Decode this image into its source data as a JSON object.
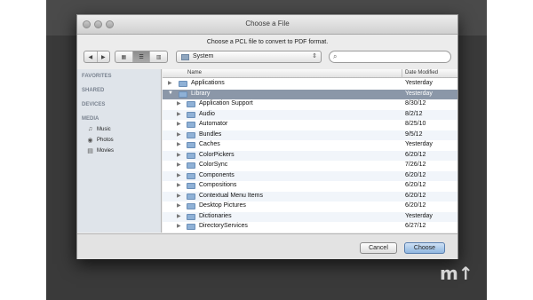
{
  "window": {
    "title": "Choose a File",
    "prompt": "Choose a PCL file to convert to PDF format."
  },
  "toolbar": {
    "back_icon": "chevron-left-icon",
    "forward_icon": "chevron-right-icon",
    "view_icons": [
      "icon-view-icon",
      "list-view-icon",
      "column-view-icon"
    ],
    "active_view": "list",
    "location": "System",
    "search_placeholder": ""
  },
  "sidebar": {
    "sections": [
      {
        "label": "FAVORITES"
      },
      {
        "label": "SHARED"
      },
      {
        "label": "DEVICES"
      },
      {
        "label": "MEDIA"
      }
    ],
    "media_items": [
      {
        "label": "Music",
        "icon": "music-note-icon"
      },
      {
        "label": "Photos",
        "icon": "camera-icon"
      },
      {
        "label": "Movies",
        "icon": "film-icon"
      }
    ]
  },
  "columns": {
    "name": "Name",
    "date": "Date Modified"
  },
  "rows": [
    {
      "name": "Applications",
      "date": "Yesterday",
      "level": 0,
      "expanded": false
    },
    {
      "name": "Library",
      "date": "Yesterday",
      "level": 0,
      "expanded": true,
      "selected": true
    },
    {
      "name": "Application Support",
      "date": "8/30/12",
      "level": 1
    },
    {
      "name": "Audio",
      "date": "8/2/12",
      "level": 1
    },
    {
      "name": "Automator",
      "date": "8/25/10",
      "level": 1
    },
    {
      "name": "Bundles",
      "date": "9/5/12",
      "level": 1
    },
    {
      "name": "Caches",
      "date": "Yesterday",
      "level": 1
    },
    {
      "name": "ColorPickers",
      "date": "6/20/12",
      "level": 1
    },
    {
      "name": "ColorSync",
      "date": "7/26/12",
      "level": 1
    },
    {
      "name": "Components",
      "date": "6/20/12",
      "level": 1
    },
    {
      "name": "Compositions",
      "date": "6/20/12",
      "level": 1
    },
    {
      "name": "Contextual Menu Items",
      "date": "6/20/12",
      "level": 1
    },
    {
      "name": "Desktop Pictures",
      "date": "6/20/12",
      "level": 1
    },
    {
      "name": "Dictionaries",
      "date": "Yesterday",
      "level": 1
    },
    {
      "name": "DirectoryServices",
      "date": "6/27/12",
      "level": 1
    }
  ],
  "buttons": {
    "cancel": "Cancel",
    "choose": "Choose"
  },
  "colors": {
    "selection": "#8b97a8",
    "sidebar": "#dfe4ea",
    "primary_button": "#8fb6e0"
  }
}
